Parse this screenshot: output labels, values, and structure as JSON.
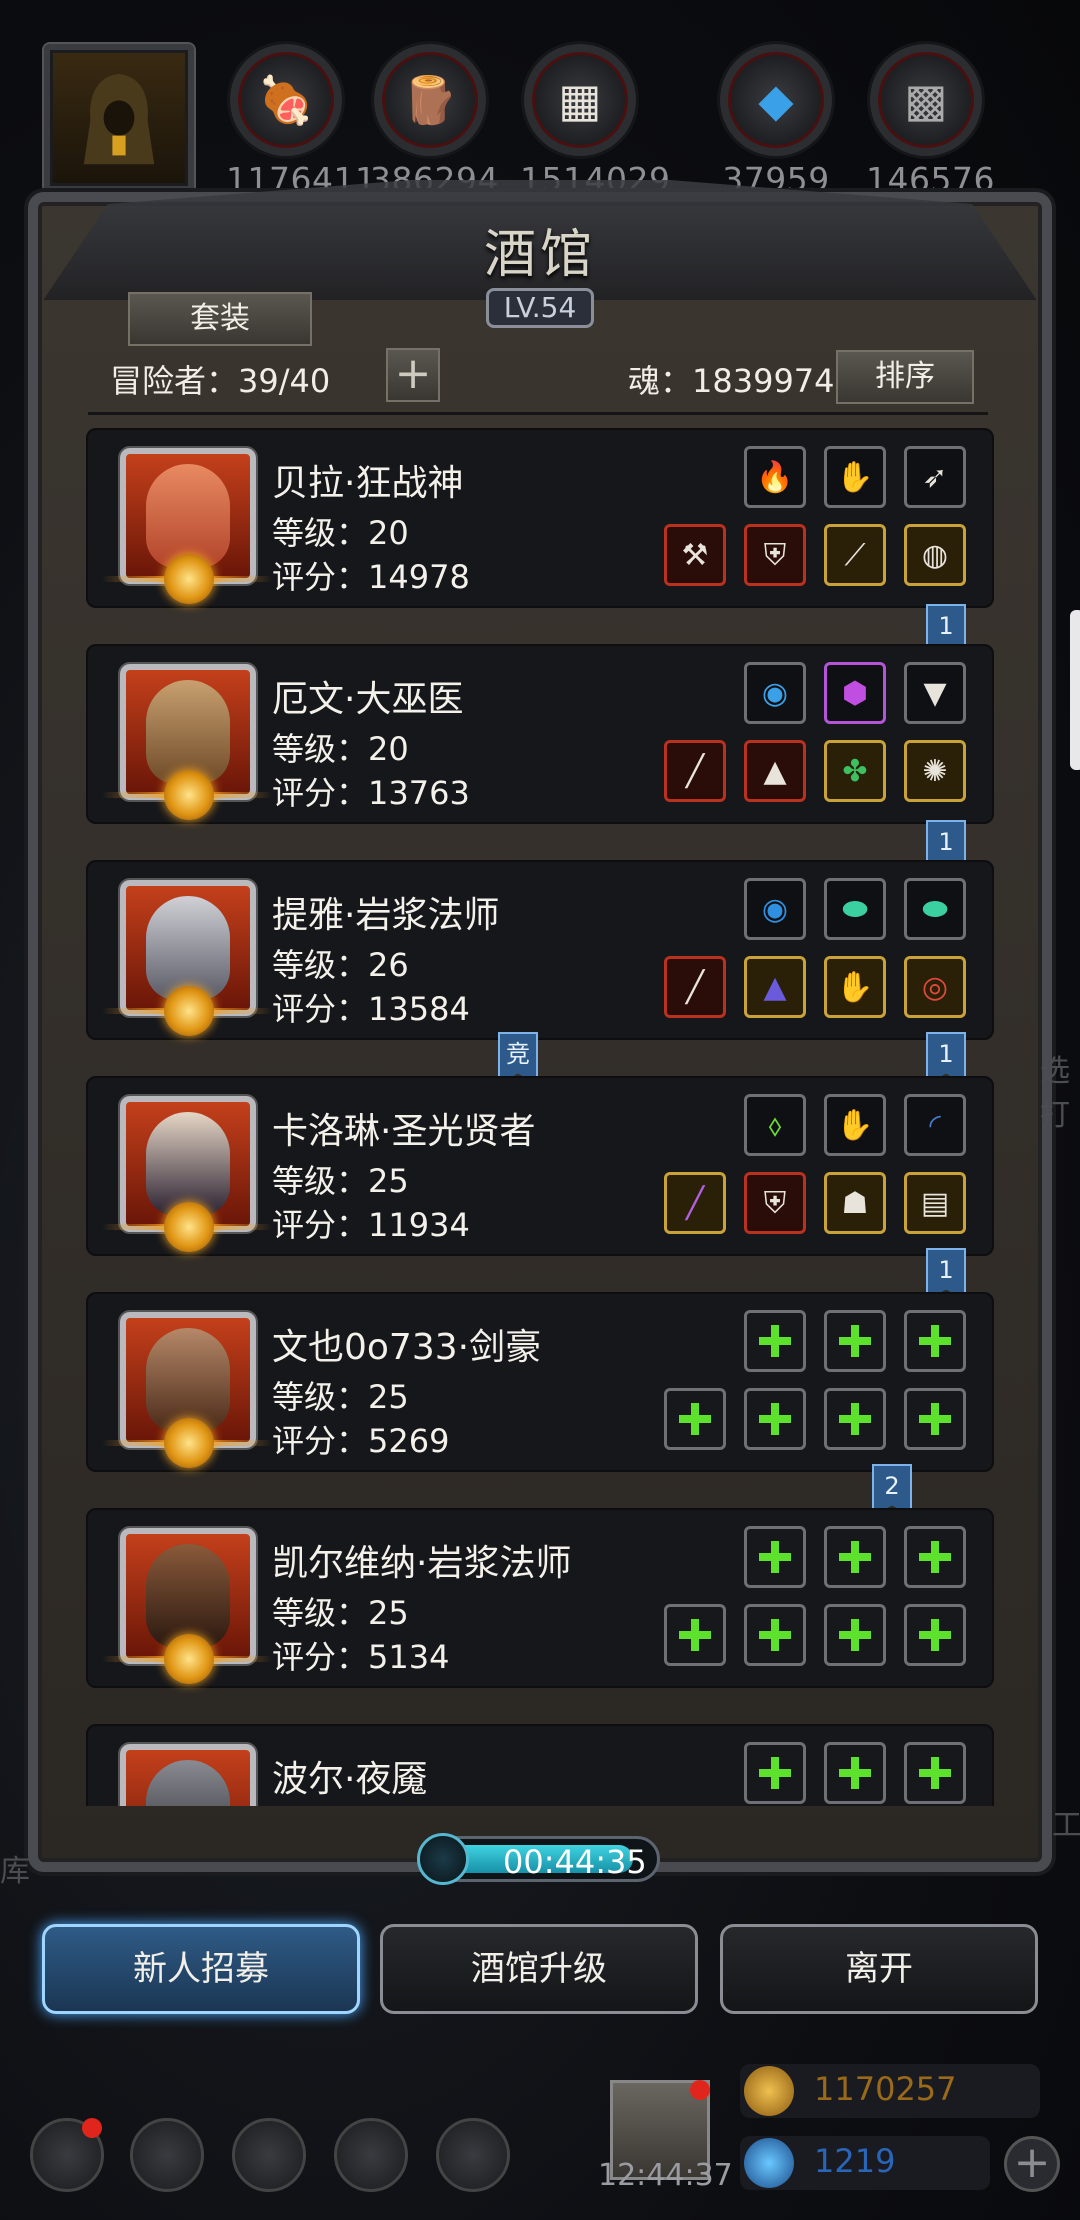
{
  "resources": [
    {
      "icon": "meat",
      "value": "1176411"
    },
    {
      "icon": "wood",
      "value": "386294"
    },
    {
      "icon": "iron",
      "value": "1514029"
    },
    {
      "icon": "crystal",
      "value": "37959"
    },
    {
      "icon": "stone",
      "value": "146576"
    }
  ],
  "panel": {
    "title": "酒馆",
    "level": "LV.54",
    "set_button": "套装",
    "adventurers": "冒险者：39/40",
    "soul": "魂：1839974",
    "sort_button": "排序"
  },
  "heroes": [
    {
      "name": "贝拉·狂战神",
      "level": "等级：20",
      "score": "评分：14978",
      "color": "#c4401b"
    },
    {
      "name": "厄文·大巫医",
      "level": "等级：20",
      "score": "评分：13763",
      "color": "#8a5a2a"
    },
    {
      "name": "提雅·岩浆法师",
      "level": "等级：26",
      "score": "评分：13584",
      "color": "#8a8a92"
    },
    {
      "name": "卡洛琳·圣光贤者",
      "level": "等级：25",
      "score": "评分：11934",
      "color": "#2a2630"
    },
    {
      "name": "文也0o733·剑豪",
      "level": "等级：25",
      "score": "评分：5269",
      "color": "#4a3020"
    },
    {
      "name": "凯尔维纳·岩浆法师",
      "level": "等级：25",
      "score": "评分：5134",
      "color": "#3a2418"
    },
    {
      "name": "波尔·夜魇",
      "level": "",
      "score": "",
      "color": "#3a3a40"
    }
  ],
  "flags": [
    "1",
    "1",
    "1",
    "1",
    "2"
  ],
  "badge_compete": "竞",
  "timer": "00:44:35",
  "buttons": {
    "recruit": "新人招募",
    "upgrade": "酒馆升级",
    "leave": "离开"
  },
  "side_left": "库",
  "side_right": "工",
  "side_right_mid": "选打",
  "bottom": {
    "clock": "12:44:37",
    "gold": "1170257",
    "gems": "1219"
  }
}
